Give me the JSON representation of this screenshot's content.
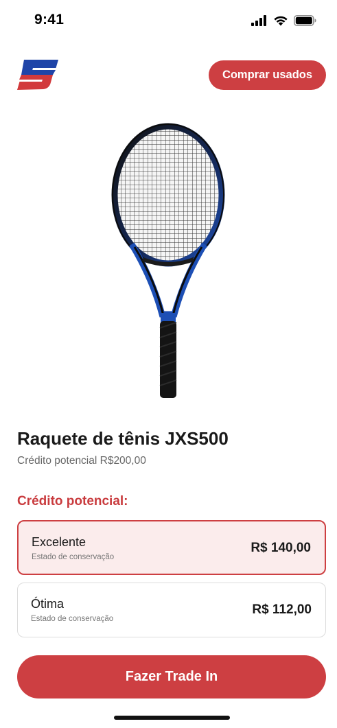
{
  "status_bar": {
    "time": "9:41",
    "icons": [
      "signal-icon",
      "wifi-icon",
      "battery-icon"
    ]
  },
  "header": {
    "logo": "brand-logo",
    "buy_used_label": "Comprar usados"
  },
  "product": {
    "image": "tennis-racket-image",
    "title": "Raquete de tênis JXS500",
    "potential_credit": "Crédito potencial R$200,00"
  },
  "credit_section": {
    "title": "Crédito potencial:",
    "options": [
      {
        "name": "Excelente",
        "subtitle": "Estado de conservação",
        "price": "R$ 140,00",
        "selected": true
      },
      {
        "name": "Ótima",
        "subtitle": "Estado de conservação",
        "price": "R$ 112,00",
        "selected": false
      }
    ]
  },
  "cta": {
    "label": "Fazer Trade In"
  },
  "colors": {
    "accent": "#cd3f42",
    "logo_blue": "#1f45a8",
    "selected_bg": "#fbecec"
  }
}
